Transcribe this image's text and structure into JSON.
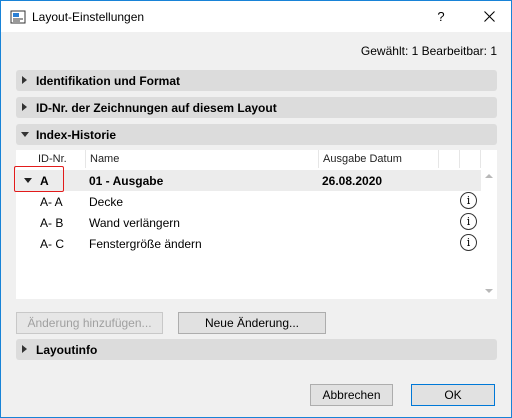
{
  "window": {
    "title": "Layout-Einstellungen",
    "help_label": "?",
    "close_label": "✕"
  },
  "selection_info": "Gewählt: 1 Bearbeitbar: 1",
  "sections": {
    "identification": "Identifikation und Format",
    "drawing_ids": "ID-Nr. der Zeichnungen auf diesem Layout",
    "index_history": "Index-Historie",
    "layoutinfo": "Layoutinfo"
  },
  "table": {
    "columns": [
      "ID-Nr.",
      "Name",
      "Ausgabe Datum"
    ],
    "issue": {
      "id": "A",
      "name": "01 - Ausgabe",
      "date": "26.08.2020"
    },
    "changes": [
      {
        "id": "A- A",
        "name": "Decke"
      },
      {
        "id": "A- B",
        "name": "Wand verlängern"
      },
      {
        "id": "A- C",
        "name": "Fenstergröße ändern"
      }
    ],
    "info_icon": "info-icon"
  },
  "buttons": {
    "add_change": "Änderung hinzufügen...",
    "new_change": "Neue Änderung...",
    "cancel": "Abbrechen",
    "ok": "OK"
  },
  "colors": {
    "highlight": "#e21b1b",
    "window_border": "#1883d7",
    "section_bg": "#dcdcdc"
  }
}
